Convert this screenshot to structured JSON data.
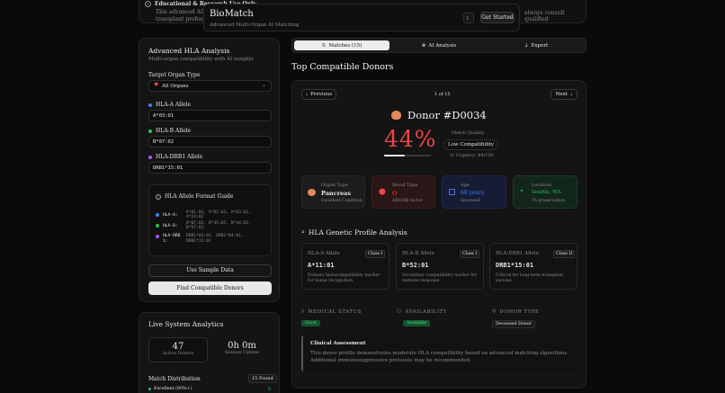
{
  "notice": {
    "title": "Educational & Research Use Only",
    "text_left": "This advanced AI sys",
    "text_left2": "transplant professio",
    "text_right": "always consult qualified"
  },
  "header": {
    "title": "BioMatch",
    "subtitle": "Advanced Multi-Organ AI Matching",
    "get_started": "Get Started"
  },
  "hla_panel": {
    "title": "Advanced HLA Analysis",
    "subtitle": "Multi-organ compatibility with AI insights",
    "organ_label": "Target Organ Type",
    "organ_value": "All Organs",
    "hla_a_label": "HLA-A Allele",
    "hla_a_value": "A*03:01",
    "hla_b_label": "HLA-B Allele",
    "hla_b_value": "B*07:02",
    "hla_drb1_label": "HLA-DRB1 Allele",
    "hla_drb1_value": "DRB1*15:01",
    "guide_title": "HLA Allele Format Guide",
    "guide": [
      {
        "key": "HLA-A:",
        "values": "A*01:01, A*02:01, A*03:01, A*24:02",
        "color": "#3b82f6"
      },
      {
        "key": "HLA-B:",
        "values": "B*07:02, B*35:01, B*44:02, B*57:01",
        "color": "#22c55e"
      },
      {
        "key": "HLA-DRB1:",
        "values": "DRB1*01:01, DRB1*04:01, DRB1*15:01",
        "color": "#a855f7"
      }
    ],
    "sample_button": "Use Sample Data",
    "find_button": "Find Compatible Donors"
  },
  "analytics": {
    "title": "Live System Analytics",
    "active_donors_value": "47",
    "active_donors_label": "Active Donors",
    "uptime_value": "0h 0m",
    "uptime_label": "Session Uptime",
    "match_dist_title": "Match Distribution",
    "found_badge": "15 Found",
    "excellent_label": "Excellent (80%+)",
    "excellent_count": "0"
  },
  "tabs": {
    "matches": "Matches (15)",
    "ai_analysis": "AI Analysis",
    "export": "Export"
  },
  "donors": {
    "section_title": "Top Compatible Donors",
    "previous": "Previous",
    "next": "Next",
    "pager": "1 of 15",
    "donor_id": "Donor #D0034",
    "match_percent": "44%",
    "match_quality_label": "Match Quality",
    "match_quality_value": "Low Compatibility",
    "urgency": "Urgency: 84/100",
    "match_fraction": 0.44,
    "info_cards": [
      {
        "label": "Organ Type",
        "value": "Pancreas",
        "sub": "Excellent Condition"
      },
      {
        "label": "Blood Type",
        "value": "O",
        "sub": "ABO/Rh factor"
      },
      {
        "label": "Age",
        "value": "60 years",
        "sub": "deceased"
      },
      {
        "label": "Location",
        "value": "Seattle, WA",
        "sub": "7h preservation"
      }
    ],
    "genetic_title": "HLA Genetic Profile Analysis",
    "alleles": [
      {
        "label": "HLA-A Allele",
        "cls": "Class I",
        "value": "A*11:01",
        "desc": "Primary histocompatibility marker for tissue recognition"
      },
      {
        "label": "HLA-B Allele",
        "cls": "Class I",
        "value": "B*52:01",
        "desc": "Secondary compatibility marker for immune response"
      },
      {
        "label": "HLA-DRB1 Allele",
        "cls": "Class II",
        "value": "DRB1*15:01",
        "desc": "Critical for long-term transplant success"
      }
    ],
    "medical_status_label": "MEDICAL STATUS",
    "medical_status_value": "Good",
    "availability_label": "AVAILABILITY",
    "availability_value": "Available",
    "donor_type_label": "DONOR TYPE",
    "donor_type_value": "Deceased Donor",
    "assessment_title": "Clinical Assessment",
    "assessment_text": "This donor profile demonstrates moderate HLA compatibility based on advanced matching algorithms. Additional immunosuppressive protocols may be recommended."
  },
  "colors": {
    "accent_red": "#ef4444",
    "blue": "#3b82f6",
    "green": "#22c55e",
    "purple": "#a855f7"
  }
}
